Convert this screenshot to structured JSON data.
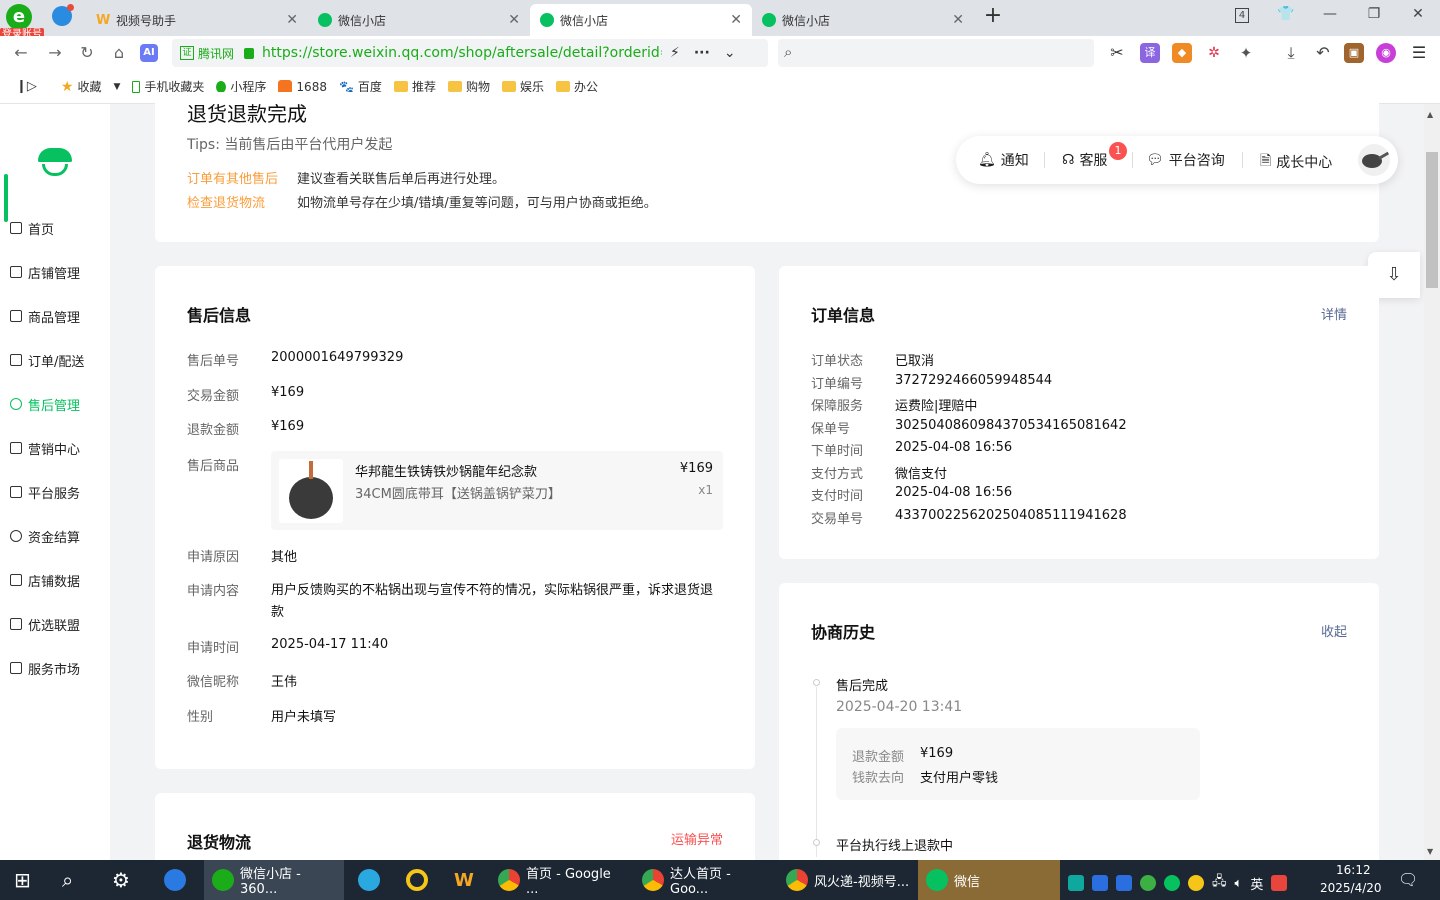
{
  "browser": {
    "login_badge": "登录账号",
    "tabs": [
      {
        "title": "视频号助手"
      },
      {
        "title": "微信小店"
      },
      {
        "title": "微信小店"
      },
      {
        "title": "微信小店"
      }
    ],
    "tab_count": "4",
    "url_site": "腾讯网",
    "url": "https://store.weixin.qq.com/shop/aftersale/detail?orderid=",
    "bookmarks": [
      "收藏",
      "手机收藏夹",
      "小程序",
      "1688",
      "百度",
      "推荐",
      "购物",
      "娱乐",
      "办公"
    ]
  },
  "sidebar": {
    "items": [
      "首页",
      "店铺管理",
      "商品管理",
      "订单/配送",
      "售后管理",
      "营销中心",
      "平台服务",
      "资金结算",
      "店铺数据",
      "优选联盟",
      "服务市场"
    ],
    "active": "售后管理"
  },
  "header_card": {
    "status": "退货退款完成",
    "tips": "Tips: 当前售后由平台代用户发起",
    "rows": [
      {
        "link": "订单有其他售后",
        "text": "建议查看关联售后单后再进行处理。"
      },
      {
        "link": "检查退货物流",
        "text": "如物流单号存在少填/错填/重复等问题，可与用户协商或拒绝。"
      }
    ]
  },
  "topbar": {
    "notify": "通知",
    "service": "客服",
    "service_badge": "1",
    "consult": "平台咨询",
    "growth": "成长中心"
  },
  "aftersale_info": {
    "title": "售后信息",
    "rows": [
      {
        "label": "售后单号",
        "value": "2000001649799329"
      },
      {
        "label": "交易金额",
        "value": "¥169"
      },
      {
        "label": "退款金额",
        "value": "¥169"
      }
    ],
    "product_label": "售后商品",
    "product": {
      "name": "华邦龍生铁铸铁炒锅龍年纪念款",
      "spec": "34CM圆底带耳【送锅盖锅铲菜刀】",
      "price": "¥169",
      "qty": "x1"
    },
    "rows2": [
      {
        "label": "申请原因",
        "value": "其他"
      },
      {
        "label": "申请内容",
        "value": "用户反馈购买的不粘锅出现与宣传不符的情况，实际粘锅很严重，诉求退货退款"
      },
      {
        "label": "申请时间",
        "value": "2025-04-17 11:40"
      },
      {
        "label": "微信昵称",
        "value": "王伟"
      },
      {
        "label": "性别",
        "value": "用户未填写"
      }
    ]
  },
  "return_logistics": {
    "title": "退货物流",
    "alert": "运输异常"
  },
  "order_info": {
    "title": "订单信息",
    "detail": "详情",
    "rows": [
      {
        "label": "订单状态",
        "value": "已取消"
      },
      {
        "label": "订单编号",
        "value": "3727292466059948544"
      },
      {
        "label": "保障服务",
        "value": "运费险|理赔中"
      },
      {
        "label": "保单号",
        "value": "30250408609843705341650816​42"
      },
      {
        "label": "下单时间",
        "value": "2025-04-08 16:56"
      },
      {
        "label": "支付方式",
        "value": "微信支付"
      },
      {
        "label": "支付时间",
        "value": "2025-04-08 16:56"
      },
      {
        "label": "交易单号",
        "value": "4337002256202504085111941628"
      }
    ]
  },
  "history": {
    "title": "协商历史",
    "collapse": "收起",
    "events": [
      {
        "title": "售后完成",
        "time": "2025-04-20 13:41",
        "details": [
          {
            "label": "退款金额",
            "value": "¥169"
          },
          {
            "label": "钱款去向",
            "value": "支付用户零钱"
          }
        ]
      },
      {
        "title": "平台执行线上退款中"
      }
    ]
  },
  "taskbar": {
    "apps": [
      "微信小店 - 360...",
      "首页 - Google ...",
      "达人首页 - Goo...",
      "风火递-视频号...",
      "微信"
    ],
    "ime": "英",
    "time": "16:12",
    "date": "2025/4/20"
  }
}
